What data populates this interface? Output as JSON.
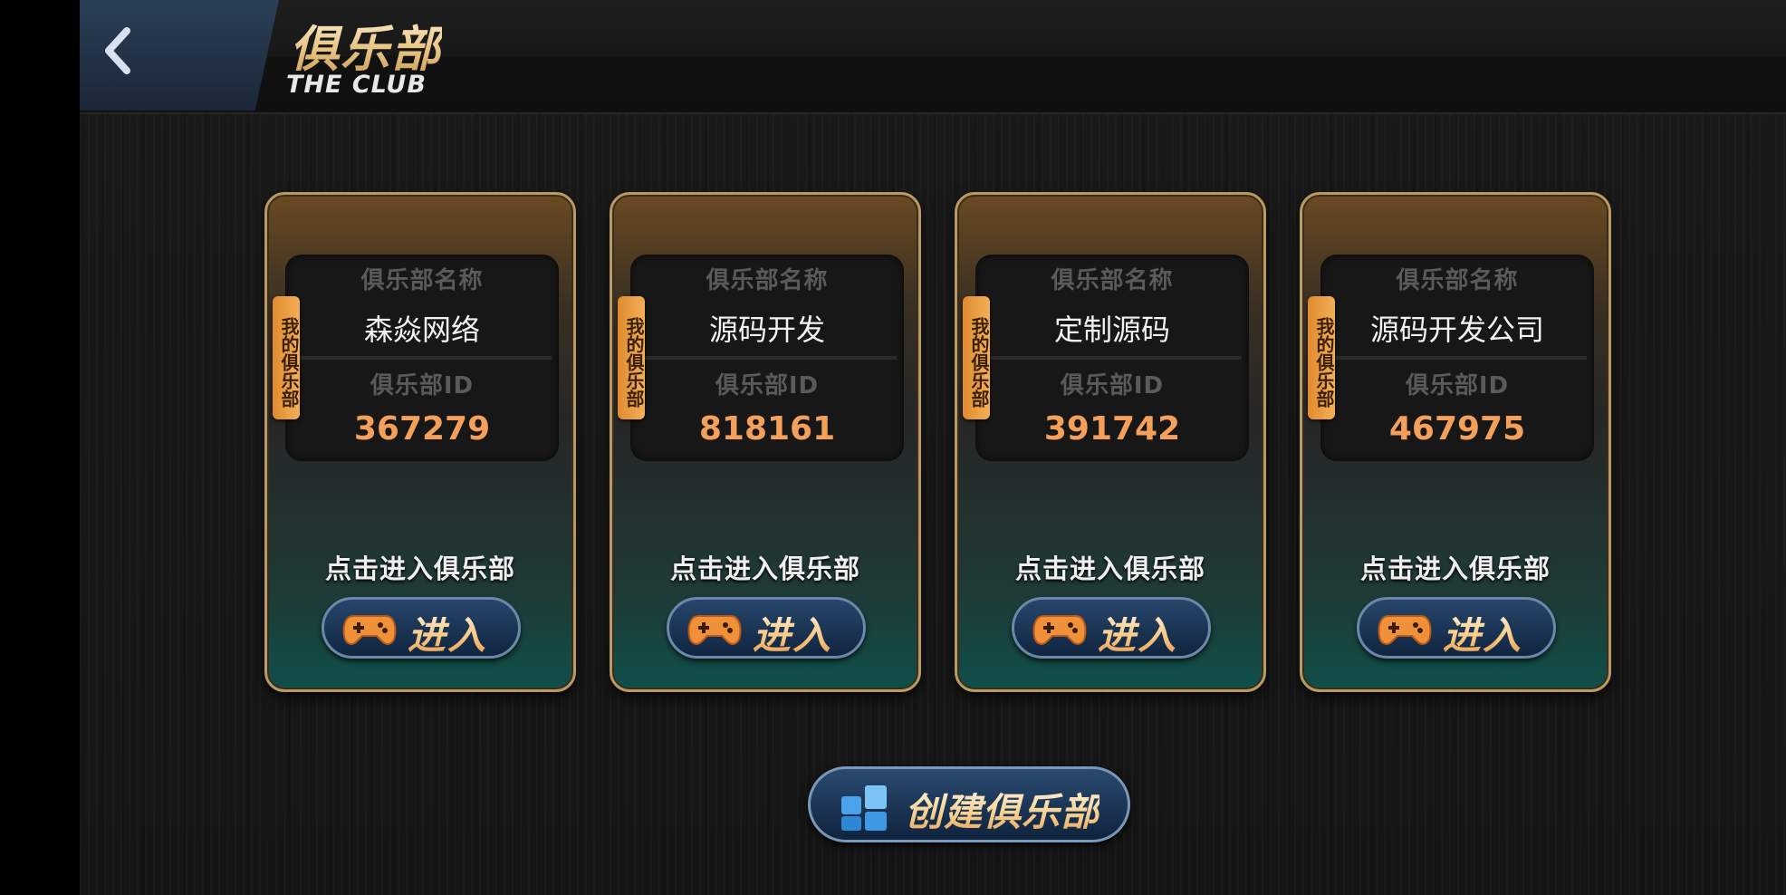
{
  "header": {
    "title_zh": "俱乐部",
    "title_en": "THE CLUB"
  },
  "clubs": [
    {
      "tag": "我的俱乐部",
      "name_label": "俱乐部名称",
      "name": "森焱网络",
      "id_label": "俱乐部ID",
      "id": "367279",
      "hint": "点击进入俱乐部",
      "enter_label": "进入"
    },
    {
      "tag": "我的俱乐部",
      "name_label": "俱乐部名称",
      "name": "源码开发",
      "id_label": "俱乐部ID",
      "id": "818161",
      "hint": "点击进入俱乐部",
      "enter_label": "进入"
    },
    {
      "tag": "我的俱乐部",
      "name_label": "俱乐部名称",
      "name": "定制源码",
      "id_label": "俱乐部ID",
      "id": "391742",
      "hint": "点击进入俱乐部",
      "enter_label": "进入"
    },
    {
      "tag": "我的俱乐部",
      "name_label": "俱乐部名称",
      "name": "源码开发公司",
      "id_label": "俱乐部ID",
      "id": "467975",
      "hint": "点击进入俱乐部",
      "enter_label": "进入"
    }
  ],
  "create_button": {
    "label": "创建俱乐部"
  },
  "colors": {
    "accent_orange": "#f4a05a",
    "card_border": "#b89a62",
    "button_blue": "#27466b"
  },
  "icons": {
    "back": "chevron-left-icon",
    "enter": "gamepad-icon",
    "create": "grid-icon"
  }
}
